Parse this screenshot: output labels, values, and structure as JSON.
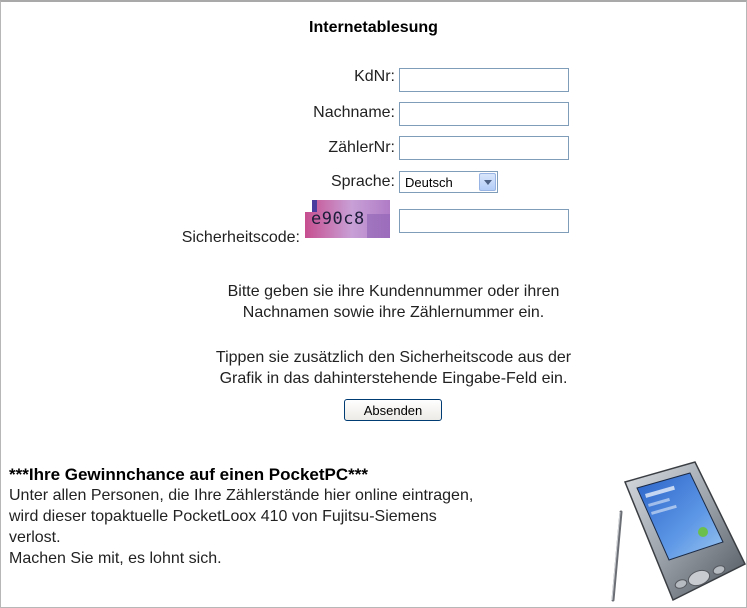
{
  "form": {
    "title": "Internetablesung",
    "fields": [
      {
        "label": "KdNr:",
        "value": ""
      },
      {
        "label": "Nachname:",
        "value": ""
      },
      {
        "label": "ZählerNr:",
        "value": ""
      }
    ],
    "language": {
      "label": "Sprache:",
      "selected": "Deutsch"
    },
    "captcha": {
      "label": "Sicherheitscode:",
      "image_text": "e90c8",
      "value": ""
    },
    "info1": [
      "Bitte geben sie ihre Kundennummer oder ihren",
      "Nachnamen sowie ihre Zählernummer ein."
    ],
    "info2": [
      "Tippen sie zusätzlich den Sicherheitscode aus der",
      "Grafik in das dahinterstehende Eingabe-Feld ein."
    ],
    "submit_label": "Absenden"
  },
  "promo": {
    "headline": "***Ihre Gewinnchance auf einen PocketPC***",
    "lines": [
      "Unter allen Personen, die Ihre Zählerstände hier online eintragen,",
      "wird dieser topaktuelle PocketLoox 410 von Fujitsu-Siemens",
      "verlost.",
      "Machen Sie mit, es lohnt sich."
    ]
  },
  "colors": {
    "input_border": "#7f9db9",
    "button_border": "#003c74",
    "captcha_bg": "#c8a0d6"
  }
}
